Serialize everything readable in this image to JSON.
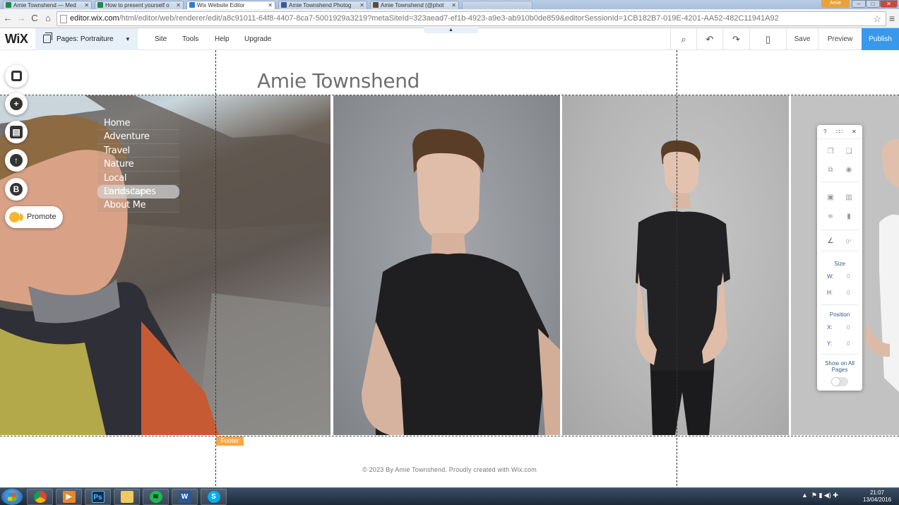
{
  "browser": {
    "tabs": [
      {
        "label": "Amie Townshend — Med",
        "favicon_color": "#1a8a4a",
        "favicon": "medium-icon"
      },
      {
        "label": "How to present yourself o",
        "favicon_color": "#1a8a4a",
        "favicon": "medium-icon"
      },
      {
        "label": "Wix Website Editor",
        "favicon_color": "#2a7fd4",
        "favicon": "wix-icon"
      },
      {
        "label": "Amie Townshend Photog",
        "favicon_color": "#3b5998",
        "favicon": "facebook-icon"
      },
      {
        "label": "Amie Townshend (@phot",
        "favicon_color": "#5d4a3a",
        "favicon": "instagram-icon"
      }
    ],
    "user_button": "Amie",
    "url_host": "editor.wix.com",
    "url_path": "/html/editor/web/renderer/edit/a8c91011-64f8-4407-8ca7-5001929a3219?metaSiteId=323aead7-ef1b-4923-a9e3-ab910b0de859&editorSessionId=1CB182B7-019E-4201-AA52-482C11941A92"
  },
  "editor": {
    "logo": "WiX",
    "pages_dropdown": "Pages: Portraiture",
    "menu": [
      "Site",
      "Tools",
      "Help",
      "Upgrade"
    ],
    "save_label": "Save",
    "preview_label": "Preview",
    "publish_label": "Publish",
    "publish_color": "#3899ec"
  },
  "left_tools": {
    "promote_label": "Promote",
    "blog_glyph": "B"
  },
  "site": {
    "title": "Amie Townshend",
    "nav": [
      "Home",
      "Adventure",
      "Travel",
      "Nature",
      "Local Landscapes",
      "Portraiture",
      "About Me"
    ],
    "selected_nav": "Portraiture",
    "footer_tag": "Footer",
    "footer_text": "© 2023 By Amie Townshend. Proudly created with Wix.com"
  },
  "panel": {
    "help": "?",
    "size_label": "Size",
    "w_label": "W:",
    "w_value": "0",
    "h_label": "H:",
    "h_value": "0",
    "position_label": "Position",
    "x_label": "X:",
    "x_value": "0",
    "y_label": "Y:",
    "y_value": "0",
    "rotate_value": "0°",
    "show_all_label": "Show on All Pages"
  },
  "taskbar": {
    "apps": [
      "chrome-icon",
      "media-player-icon",
      "photoshop-icon",
      "file-explorer-icon",
      "spotify-icon",
      "word-icon",
      "skype-icon"
    ],
    "ps_glyph": "Ps",
    "word_glyph": "W",
    "skype_glyph": "S",
    "time": "21:07",
    "date": "13/04/2016"
  }
}
